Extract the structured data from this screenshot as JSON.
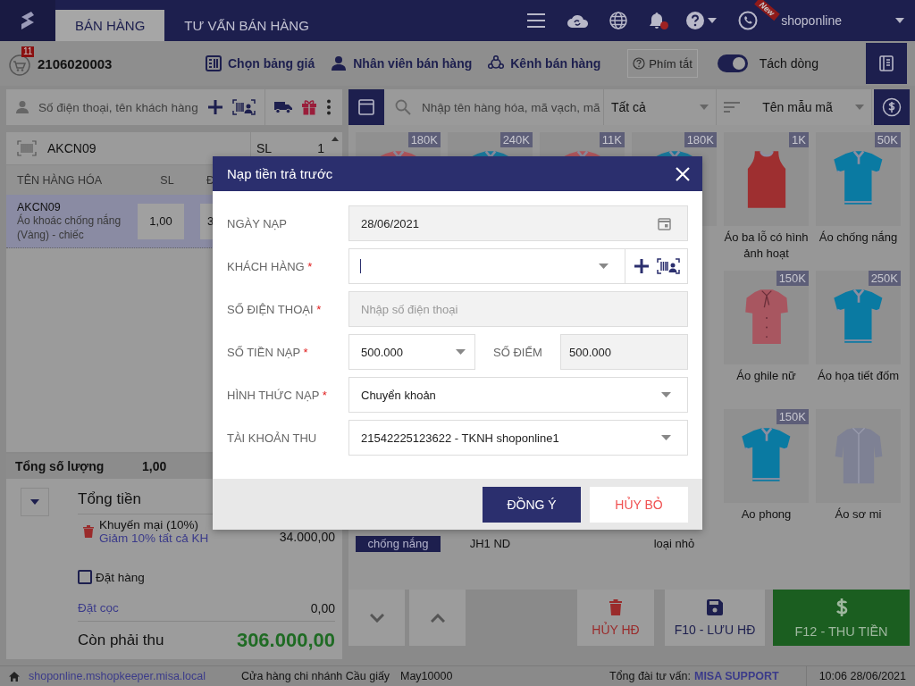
{
  "top_bar": {
    "tabs": [
      {
        "label": "BÁN HÀNG",
        "selected": true
      },
      {
        "label": "TƯ VẤN BÁN HÀNG",
        "selected": false
      }
    ],
    "notification": true,
    "new_badge": "New",
    "user": "shoponline"
  },
  "toolbar": {
    "invoice_count": "11",
    "invoice_number": "2106020003",
    "actions": [
      {
        "kind": "price",
        "label": "Chọn bảng giá"
      },
      {
        "kind": "staff",
        "label": "Nhân viên bán hàng"
      },
      {
        "kind": "channel",
        "label": "Kênh bán hàng"
      }
    ],
    "shortcut_button": "Phím tắt",
    "split_toggle": {
      "label": "Tách dòng",
      "on": true
    }
  },
  "cart": {
    "customer_search": {
      "placeholder": "Số điện thoại, tên khách hàng"
    },
    "barcode_value": "AKCN09",
    "qty_label": "SL",
    "qty_value": "1",
    "columns": [
      "TÊN HÀNG HÓA",
      "SL",
      "Đ"
    ],
    "rows": [
      {
        "code": "AKCN09",
        "name": "Áo khoác chống nắng (Vàng) - chiếc",
        "qty": "1,00",
        "price": "3",
        "selected": true
      }
    ],
    "total_qty_label": "Tổng số lượng",
    "total_qty": "1,00",
    "summary": {
      "total_label": "Tổng tiền",
      "promo_label": "Khuyến mại (10%)",
      "promo_link": "Giảm 10% tất cả KH",
      "promo_amount": "34.000,00",
      "order": {
        "label": "Đặt hàng",
        "checked": false
      },
      "deposit_label": "Đặt cọc",
      "deposit_amount": "0,00",
      "due_label": "Còn phải thu",
      "due_amount": "306.000,00"
    }
  },
  "products": {
    "search": {
      "placeholder": "Nhập tên hàng hóa, mã vạch, mã"
    },
    "category": "Tất cả",
    "sort": "Tên mẫu mã",
    "tiles": [
      {
        "kind": "polo",
        "color": "#b0575e",
        "price": "180K"
      },
      {
        "kind": "polo",
        "color": "#1a7a9e",
        "price": "240K"
      },
      {
        "kind": "polo",
        "color": "#b0575e",
        "price": "11K"
      },
      {
        "kind": "polo",
        "color": "#1a7a9e",
        "price": "180K"
      },
      {
        "kind": "tank",
        "color": "#9e2f30",
        "price": "1K",
        "name": "Áo ba lỗ có hình ảnh hoạt",
        "selected": false
      },
      {
        "kind": "polo",
        "color": "#0a7aa2",
        "price": "50K",
        "name": "Áo chống nắng",
        "selected": false
      },
      {
        "kind": "blouse",
        "color": "#a85660",
        "price": "150K",
        "name": "Áo ghile nữ",
        "selected": false
      },
      {
        "kind": "polo",
        "color": "#0a7aa2",
        "price": "250K",
        "name": "Áo họa tiết đốm",
        "selected": false
      },
      {
        "kind": "polo",
        "color": "#0a7aa2",
        "price": "150K",
        "name": "Ao phong",
        "selected": false
      },
      {
        "kind": "shirt",
        "color": "#7e8194",
        "name": "Áo sơ mi",
        "selected": false
      }
    ],
    "cut_labels": [
      {
        "text": "chống nắng",
        "selected": true
      },
      {
        "text": "JH1 ND",
        "selected": false
      },
      {
        "text": "loại nhỏ",
        "selected": false
      }
    ]
  },
  "actions": [
    {
      "kind": "down"
    },
    {
      "kind": "up"
    },
    {
      "kind": "cancel",
      "label": "HỦY HĐ"
    },
    {
      "kind": "save",
      "label": "F10 - LƯU HĐ"
    },
    {
      "kind": "pay",
      "label": "F12 - THU TIỀN"
    }
  ],
  "status_bar": {
    "host": "shoponline.mshopkeeper.misa.local",
    "branch": "Cửa hàng chi nhánh Cầu giấy",
    "device": "May10000",
    "hotline_label": "Tổng đài tư vấn:",
    "hotline": "MISA SUPPORT",
    "datetime": "10:06 28/06/2021"
  },
  "dialog": {
    "title": "Nạp tiền trả trước",
    "required_mark": "*",
    "fields": [
      {
        "kind": "date",
        "label": "NGÀY NẠP",
        "value": "28/06/2021",
        "required": false
      },
      {
        "kind": "customer",
        "label": "KHÁCH HÀNG",
        "required": true
      },
      {
        "kind": "text",
        "label": "SỐ ĐIỆN THOẠI",
        "placeholder": "Nhập số điện thoại",
        "required": true
      },
      {
        "kind": "amount",
        "label": "SỐ TIỀN NẠP",
        "value": "500.000",
        "required": true,
        "points_label": "SỐ ĐIỂM",
        "points": "500.000"
      },
      {
        "kind": "select",
        "label": "HÌNH THỨC NẠP",
        "value": "Chuyển khoản",
        "required": true
      },
      {
        "kind": "select",
        "label": "TÀI KHOẢN THU",
        "value": "21542225123622 - TKNH shoponline1",
        "required": false
      }
    ],
    "buttons": [
      {
        "kind": "primary",
        "label": "ĐỒNG Ý"
      },
      {
        "kind": "secondary",
        "label": "HỦY BỎ"
      }
    ]
  }
}
